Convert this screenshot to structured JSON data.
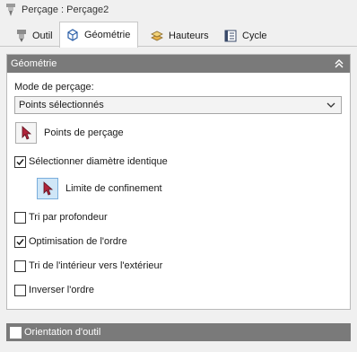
{
  "window": {
    "title": "Perçage : Perçage2"
  },
  "tabs": [
    {
      "label": "Outil",
      "active": false,
      "icon": "tool-holder-icon"
    },
    {
      "label": "Géométrie",
      "active": true,
      "icon": "geometry-cube-icon"
    },
    {
      "label": "Hauteurs",
      "active": false,
      "icon": "heights-stack-icon"
    },
    {
      "label": "Cycle",
      "active": false,
      "icon": "cycle-list-icon"
    }
  ],
  "geometry_panel": {
    "header": "Géométrie",
    "mode_label": "Mode de perçage:",
    "mode_value": "Points sélectionnés",
    "drill_points_label": "Points de perçage",
    "same_diameter_label": "Sélectionner diamètre identique",
    "same_diameter_checked": true,
    "boundary_label": "Limite de confinement",
    "sort_depth_label": "Tri par profondeur",
    "sort_depth_checked": false,
    "optimize_order_label": "Optimisation de l'ordre",
    "optimize_order_checked": true,
    "sort_inside_out_label": "Tri de l'intérieur vers l'extérieur",
    "sort_inside_out_checked": false,
    "reverse_order_label": "Inverser l'ordre",
    "reverse_order_checked": false
  },
  "tool_orientation": {
    "label": "Orientation d'outil",
    "checked": false
  },
  "colors": {
    "header_bg": "#7a7a7a",
    "cursor_red": "#b0243a",
    "highlight": "#cfe6f7"
  }
}
